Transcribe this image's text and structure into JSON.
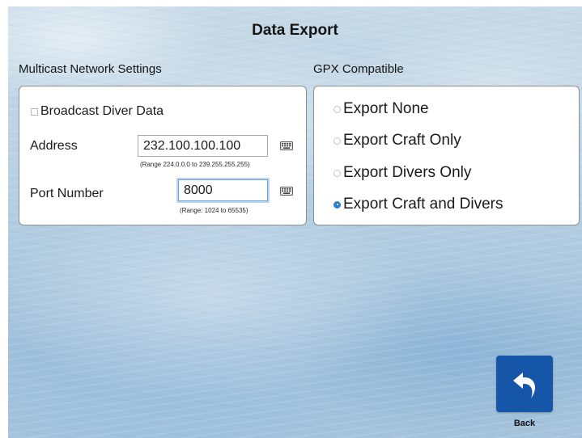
{
  "page": {
    "title": "Data Export"
  },
  "multicast": {
    "header": "Multicast Network Settings",
    "broadcast_label": "Broadcast Diver Data",
    "broadcast_checked": false,
    "address_label": "Address",
    "address_value": "232.100.100.100",
    "address_range": "(Range 224.0.0.0 to 239.255.255.255)",
    "port_label": "Port Number",
    "port_value": "8000",
    "port_range": "(Range: 1024 to 65535)",
    "keyboard_icon": "keyboard-icon"
  },
  "gpx": {
    "header": "GPX Compatible",
    "options": [
      {
        "label": "Export None",
        "selected": false
      },
      {
        "label": "Export Craft Only",
        "selected": false
      },
      {
        "label": "Export Divers Only",
        "selected": false
      },
      {
        "label": "Export Craft and Divers",
        "selected": true
      }
    ]
  },
  "footer": {
    "back_label": "Back",
    "back_icon": "back-arrow-icon",
    "back_color": "#1656a8"
  },
  "colors": {
    "accent": "#2b7fd4",
    "focus": "#6aa3db"
  }
}
